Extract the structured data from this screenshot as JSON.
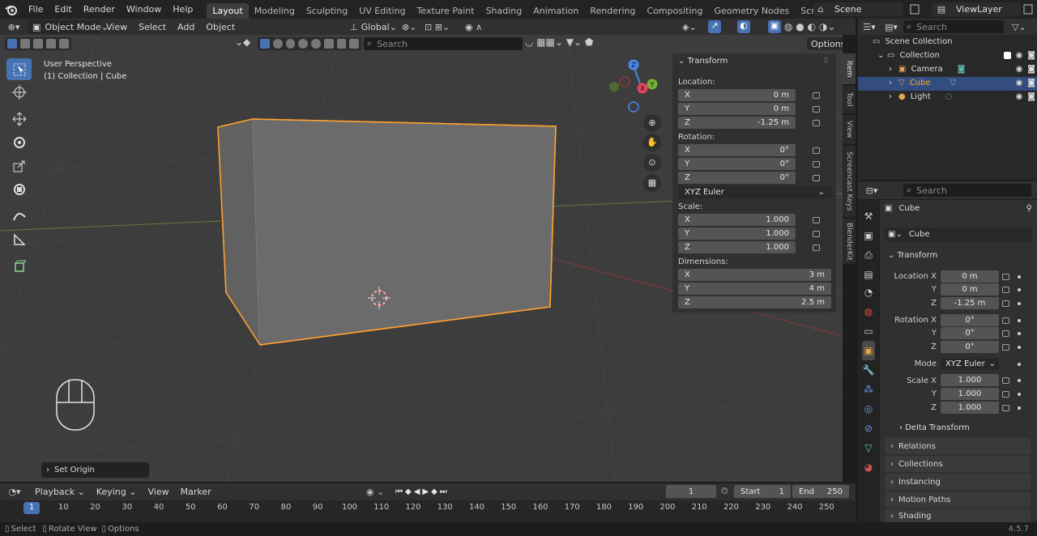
{
  "menu": [
    "File",
    "Edit",
    "Render",
    "Window",
    "Help"
  ],
  "workspaces": [
    "Layout",
    "Modeling",
    "Sculpting",
    "UV Editing",
    "Texture Paint",
    "Shading",
    "Animation",
    "Rendering",
    "Compositing",
    "Geometry Nodes",
    "Scripting"
  ],
  "scene_name": "Scene",
  "view_layer": "ViewLayer",
  "outliner_search": "Search",
  "header": {
    "mode": "Object Mode",
    "menus": [
      "View",
      "Select",
      "Add",
      "Object"
    ],
    "orientation": "Global",
    "search": "Search",
    "options": "Options"
  },
  "viewport": {
    "perspective": "User Perspective",
    "context": "(1) Collection | Cube",
    "last_op": "Set Origin"
  },
  "gizmo": {
    "x": "X",
    "y": "Y",
    "z": "Z"
  },
  "npanel": {
    "title": "Transform",
    "location_label": "Location:",
    "location": [
      {
        "axis": "X",
        "value": "0 m"
      },
      {
        "axis": "Y",
        "value": "0 m"
      },
      {
        "axis": "Z",
        "value": "-1.25 m"
      }
    ],
    "rotation_label": "Rotation:",
    "rotation": [
      {
        "axis": "X",
        "value": "0°"
      },
      {
        "axis": "Y",
        "value": "0°"
      },
      {
        "axis": "Z",
        "value": "0°"
      }
    ],
    "rotation_mode": "XYZ Euler",
    "scale_label": "Scale:",
    "scale": [
      {
        "axis": "X",
        "value": "1.000"
      },
      {
        "axis": "Y",
        "value": "1.000"
      },
      {
        "axis": "Z",
        "value": "1.000"
      }
    ],
    "dimensions_label": "Dimensions:",
    "dimensions": [
      {
        "axis": "X",
        "value": "3 m"
      },
      {
        "axis": "Y",
        "value": "4 m"
      },
      {
        "axis": "Z",
        "value": "2.5 m"
      }
    ]
  },
  "side_tabs": [
    "Item",
    "Tool",
    "View",
    "Screencast Keys",
    "BlenderKit"
  ],
  "outliner": {
    "root": "Scene Collection",
    "collection": "Collection",
    "items": [
      "Camera",
      "Cube",
      "Light"
    ]
  },
  "properties": {
    "search": "Search",
    "object_name": "Cube",
    "data_name": "Cube",
    "transform_title": "Transform",
    "location_x_label": "Location X",
    "y_label": "Y",
    "z_label": "Z",
    "location": [
      "0 m",
      "0 m",
      "-1.25 m"
    ],
    "rotation_x_label": "Rotation X",
    "rotation": [
      "0°",
      "0°",
      "0°"
    ],
    "mode_label": "Mode",
    "mode": "XYZ Euler",
    "scale_x_label": "Scale X",
    "scale": [
      "1.000",
      "1.000",
      "1.000"
    ],
    "delta": "Delta Transform",
    "sections": [
      "Relations",
      "Collections",
      "Instancing",
      "Motion Paths",
      "Shading"
    ]
  },
  "timeline": {
    "menus": [
      "Playback",
      "Keying",
      "View",
      "Marker"
    ],
    "current_frame": "1",
    "start_label": "Start",
    "start": "1",
    "end_label": "End",
    "end": "250",
    "ticks": [
      "1",
      "10",
      "20",
      "30",
      "40",
      "50",
      "60",
      "70",
      "80",
      "90",
      "100",
      "110",
      "120",
      "130",
      "140",
      "150",
      "160",
      "170",
      "180",
      "190",
      "200",
      "210",
      "220",
      "230",
      "240",
      "250"
    ]
  },
  "status": {
    "select": "Select",
    "rotate": "Rotate View",
    "options": "Options",
    "version": "4.5.7"
  }
}
